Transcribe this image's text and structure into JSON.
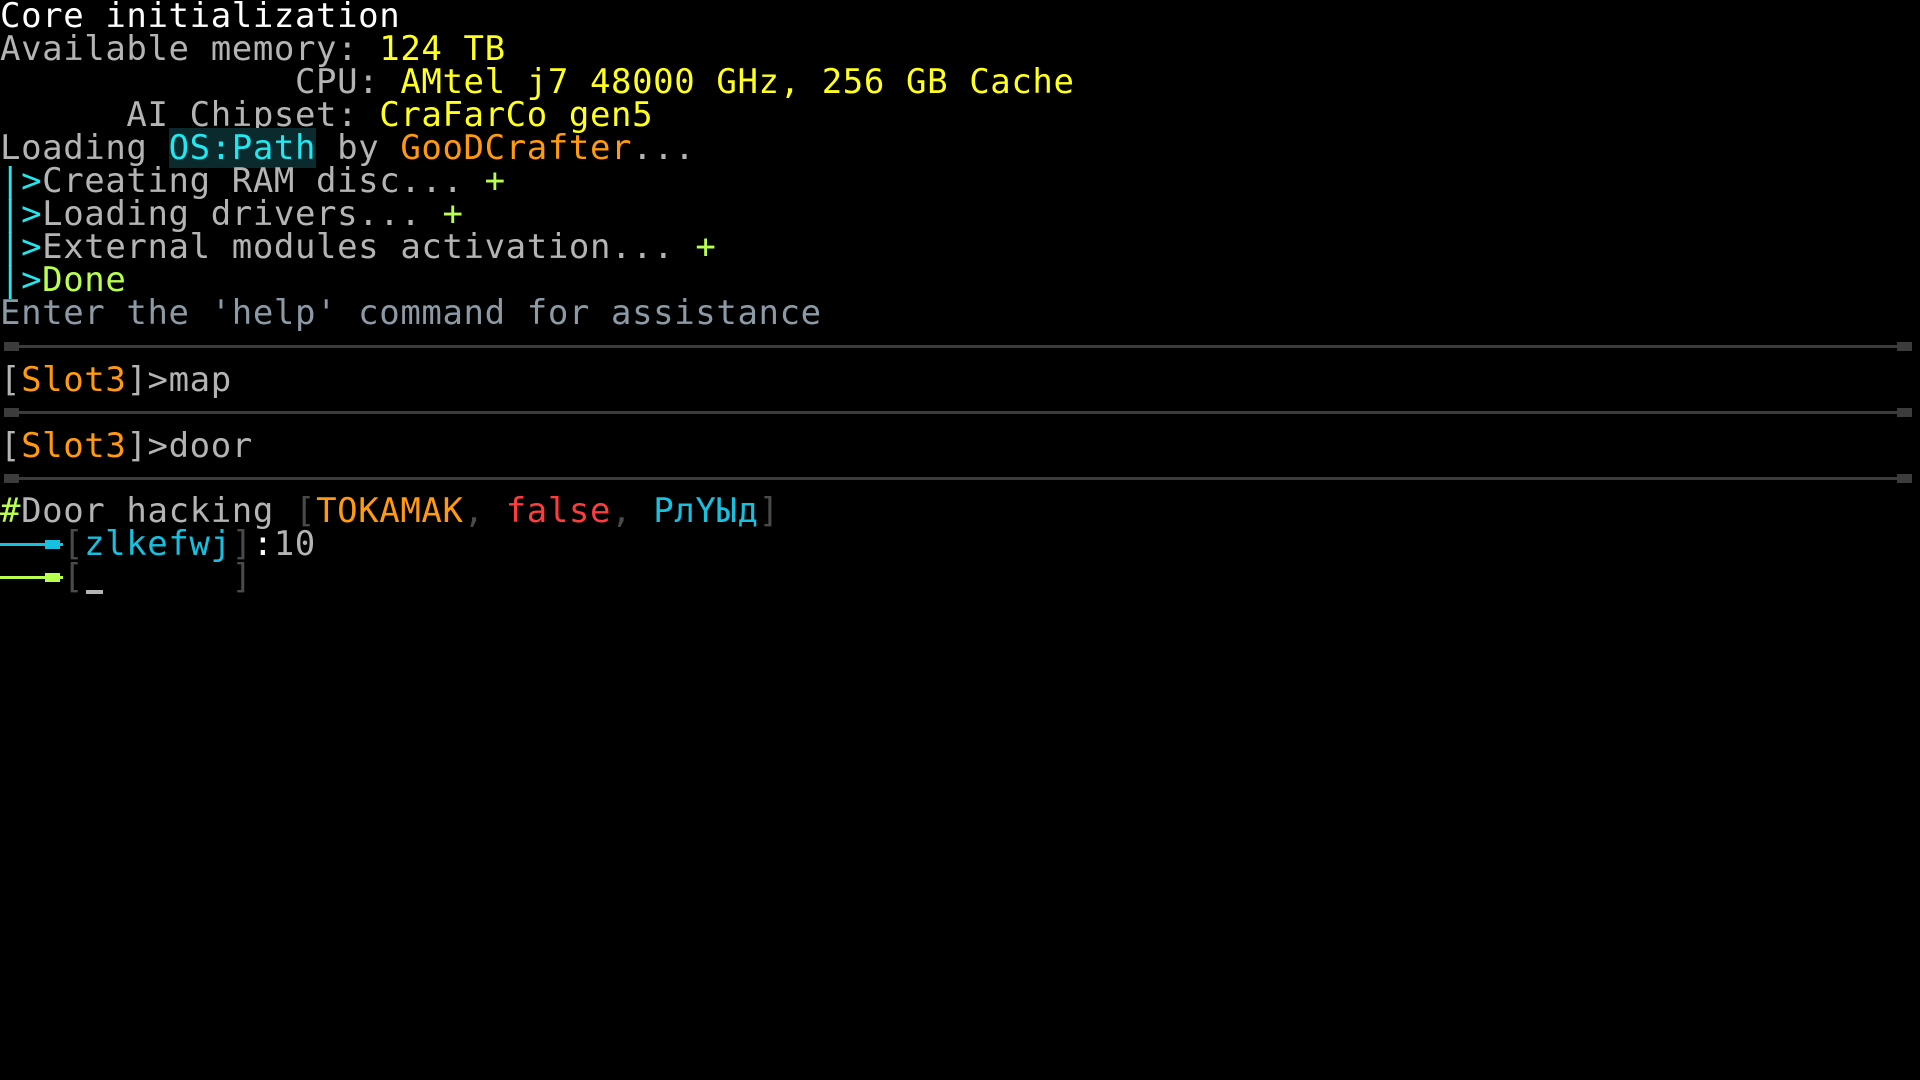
{
  "boot": {
    "title": "Core initialization",
    "memory_label": "Available memory: ",
    "memory_value": "124 TB",
    "cpu_label": "              CPU: ",
    "cpu_value": "AMtel j7 48000 GHz, 256 GB Cache",
    "chipset_label": "      AI Chipset: ",
    "chipset_value": "CraFarCo gen5",
    "loading_prefix": "Loading ",
    "os_name": "OS:Path",
    "loading_by": " by ",
    "author": "GooDCrafter",
    "loading_ellipsis": "...",
    "steps": [
      {
        "marker": "|>",
        "text": "Creating RAM disc... ",
        "status": "+"
      },
      {
        "marker": "|>",
        "text": "Loading drivers... ",
        "status": "+"
      },
      {
        "marker": "|>",
        "text": "External modules activation... ",
        "status": "+"
      }
    ],
    "done_marker": "|>",
    "done_text": "Done",
    "help_hint": "Enter the 'help' command for assistance"
  },
  "commands": [
    {
      "open": "[",
      "slot": "Slot3",
      "close": "]",
      "prompt": ">",
      "command": "map"
    },
    {
      "open": "[",
      "slot": "Slot3",
      "close": "]",
      "prompt": ">",
      "command": "door"
    }
  ],
  "door_hacking": {
    "hash": "#",
    "title": "Door hacking ",
    "open": "[",
    "target": "TOKAMAK",
    "sep1": ", ",
    "state": "false",
    "sep2": ", ",
    "code": "PлYЫд",
    "close": "]",
    "attempts": [
      {
        "open": "[",
        "guess": "zlkefwj",
        "close": "]",
        "colon": ":",
        "score": "10"
      }
    ],
    "input": {
      "open": "[",
      "value": "",
      "padding": "      ",
      "close": "]"
    }
  },
  "colors": {
    "background": "#000000",
    "text": "#b4b4b4",
    "value_yellow": "#ffff20",
    "accent_orange": "#ff9a10",
    "accent_cyan": "#20e8f0",
    "success_green": "#b8ff50",
    "error_red": "#ff3c3c",
    "separator": "#3c3c3c"
  }
}
